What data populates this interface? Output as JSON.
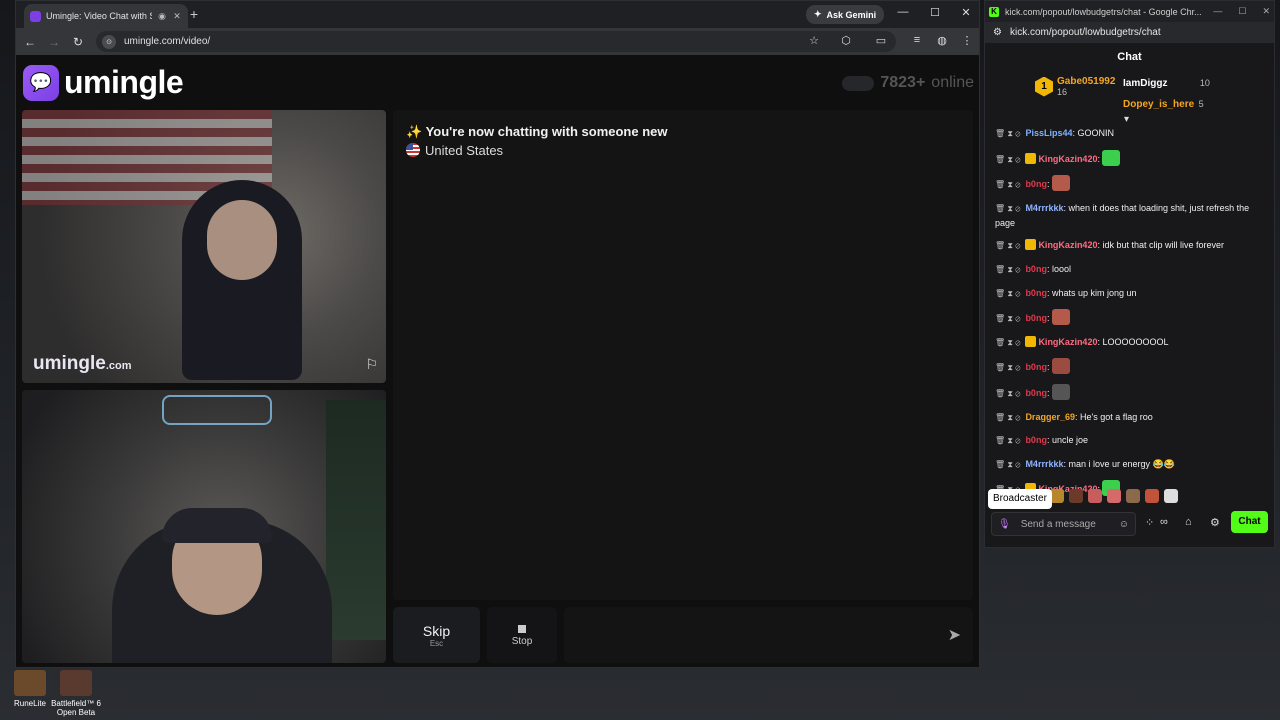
{
  "browser": {
    "tab_title": "Umingle: Video Chat with S",
    "gemini_label": "Ask Gemini",
    "url": "umingle.com/video/"
  },
  "page": {
    "logo_word": "umingle",
    "online_count": "7823+",
    "online_label": "online",
    "watermark": "umingle",
    "watermark_suffix": ".com",
    "system_message": "You're now chatting with someone new",
    "country": "United States",
    "skip_label": "Skip",
    "skip_key": "Esc",
    "stop_label": "Stop"
  },
  "popout": {
    "window_title": "kick.com/popout/lowbudgetrs/chat - Google Chr...",
    "url": "kick.com/popout/lowbudgetrs/chat",
    "header": "Chat",
    "gifters": [
      {
        "name": "Gabe051992",
        "count": "16",
        "rank": "1"
      },
      {
        "name": "IamDiggz",
        "count": "10"
      },
      {
        "name": "Dopey_is_here",
        "count": "5"
      }
    ],
    "messages": [
      {
        "user": "PissLips44",
        "text": "GOONIN",
        "color": "#7fb3ff"
      },
      {
        "user": "KingKazin420",
        "text": "",
        "color": "#ff6b81",
        "crown": true,
        "emote": "#3ccf4e"
      },
      {
        "user": "b0ng",
        "text": "",
        "color": "#e0394b",
        "emote": "#b35a4a"
      },
      {
        "user": "M4rrrkkk",
        "text": "when it does that loading shit, just refresh the page",
        "color": "#8fb4ff"
      },
      {
        "user": "KingKazin420",
        "text": "idk but that clip will live forever",
        "color": "#ff6b81",
        "crown": true
      },
      {
        "user": "b0ng",
        "text": "loool",
        "color": "#e0394b"
      },
      {
        "user": "b0ng",
        "text": "whats up kim jong un",
        "color": "#e0394b"
      },
      {
        "user": "b0ng",
        "text": "",
        "color": "#e0394b",
        "emote": "#b35a4a"
      },
      {
        "user": "KingKazin420",
        "text": "LOOOOOOOOL",
        "color": "#ff6b81",
        "crown": true
      },
      {
        "user": "b0ng",
        "text": "",
        "color": "#e0394b",
        "emote": "#9b4b3f"
      },
      {
        "user": "b0ng",
        "text": "",
        "color": "#e0394b",
        "emote": "#555"
      },
      {
        "user": "Dragger_69",
        "text": "He's got a flag roo",
        "color": "#f5a623"
      },
      {
        "user": "b0ng",
        "text": "uncle joe",
        "color": "#e0394b"
      },
      {
        "user": "M4rrrkkk",
        "text": "man i love ur energy 😂😂",
        "color": "#8fb4ff"
      },
      {
        "user": "KingKazin420",
        "text": "",
        "color": "#ff6b81",
        "crown": true,
        "emote": "#3ccf4e"
      }
    ],
    "broadcaster_label": "Broadcaster",
    "input_placeholder": "Send a message",
    "chat_button": "Chat"
  },
  "desktop": {
    "icons": [
      {
        "label": "RuneLite"
      },
      {
        "label": "Battlefield™ 6 Open Beta"
      }
    ]
  }
}
